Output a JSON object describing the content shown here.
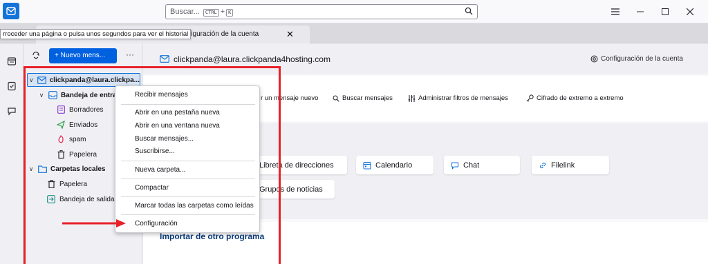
{
  "titlebar": {
    "search_placeholder": "Buscar...",
    "shortcut_ctrl": "CTRL",
    "shortcut_plus": "+",
    "shortcut_key": "K"
  },
  "tab": {
    "title": "nfiguración de la cuenta",
    "close": "✕"
  },
  "tooltip": "rroceder una página o pulsa unos segundos para ver el historial",
  "folder_pane": {
    "new_message": "+ Nuevo mens...",
    "more": "···",
    "account": "clickpanda@laura.clickpa...",
    "inbox": "Bandeja de entrad",
    "drafts": "Borradores",
    "sent": "Enviados",
    "spam": "spam",
    "trash": "Papelera",
    "local_folders": "Carpetas locales",
    "local_trash": "Papelera",
    "outbox": "Bandeja de salida"
  },
  "main": {
    "account_email": "clickpanda@laura.clickpanda4hosting.com",
    "account_settings": "Configuración de la cuenta",
    "actions": {
      "write_message": "r un mensaje nuevo",
      "search_messages": "Buscar mensajes",
      "manage_filters": "Administrar filtros de mensajes",
      "e2e_encryption": "Cifrado de extremo a extremo"
    },
    "cards": {
      "address_book": "Libreta de direcciones",
      "calendar": "Calendario",
      "chat": "Chat",
      "filelink": "Filelink",
      "newsgroups": "Grupos de noticias"
    },
    "import_title": "Importar de otro programa"
  },
  "context_menu": {
    "get_messages": "Recibir mensajes",
    "open_new_tab": "Abrir en una pestaña nueva",
    "open_new_window": "Abrir en una ventana nueva",
    "search_messages": "Buscar mensajes...",
    "subscribe": "Suscribirse...",
    "new_folder": "Nueva carpeta...",
    "compact": "Compactar",
    "mark_all_read": "Marcar todas las carpetas como leídas",
    "settings": "Configuración"
  },
  "colors": {
    "accent": "#0061e0",
    "annotation": "#e8202a"
  }
}
